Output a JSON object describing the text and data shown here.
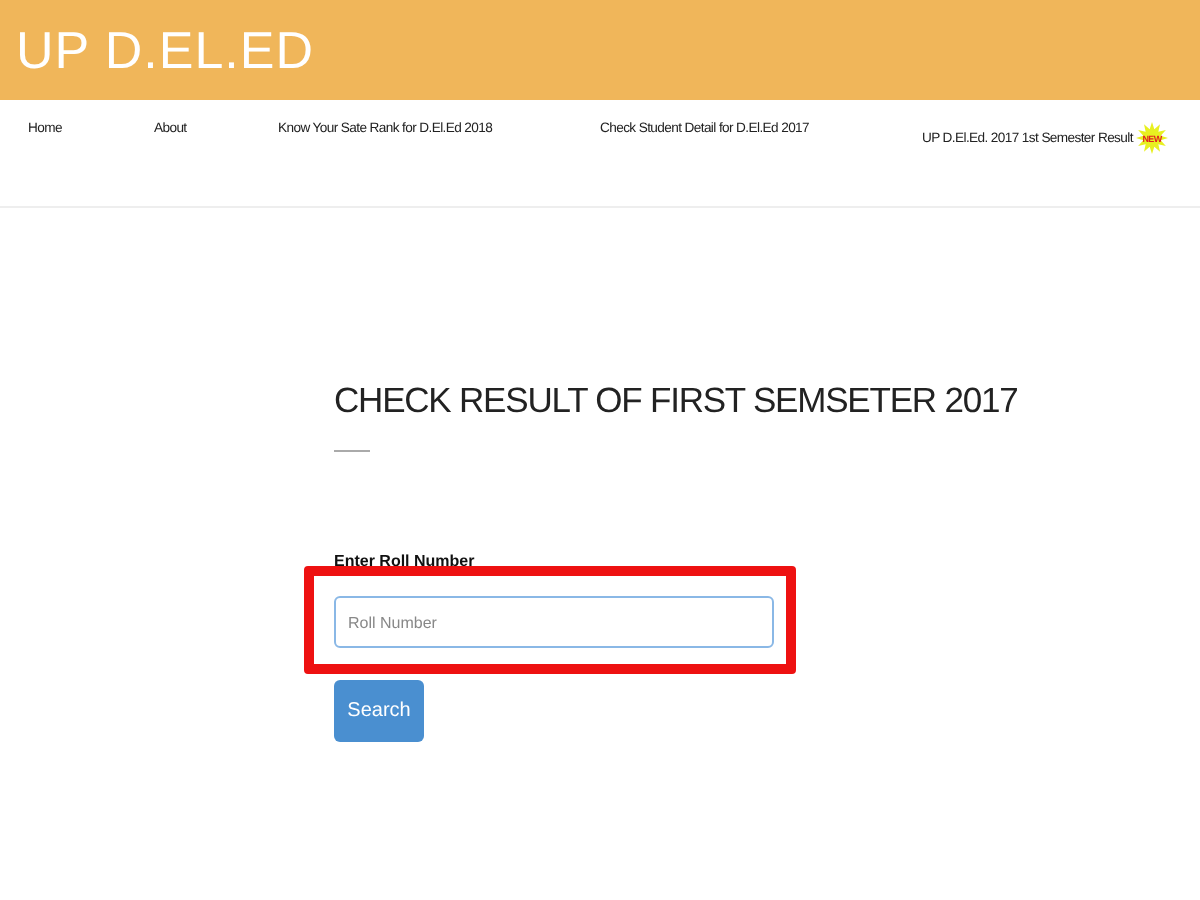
{
  "header": {
    "title": "UP D.EL.ED"
  },
  "nav": [
    {
      "label": "Home"
    },
    {
      "label": "About"
    },
    {
      "label": "Know Your Sate Rank for D.El.Ed 2018"
    },
    {
      "label": "Check Student Detail for D.El.Ed 2017"
    },
    {
      "label": "UP D.El.Ed. 2017 1st Semester Result",
      "badge": "NEW"
    }
  ],
  "main": {
    "heading": "CHECK RESULT OF FIRST SEMSETER 2017",
    "field_label": "Enter Roll Number",
    "placeholder": "Roll Number",
    "highlighted": true,
    "button": "Search"
  }
}
